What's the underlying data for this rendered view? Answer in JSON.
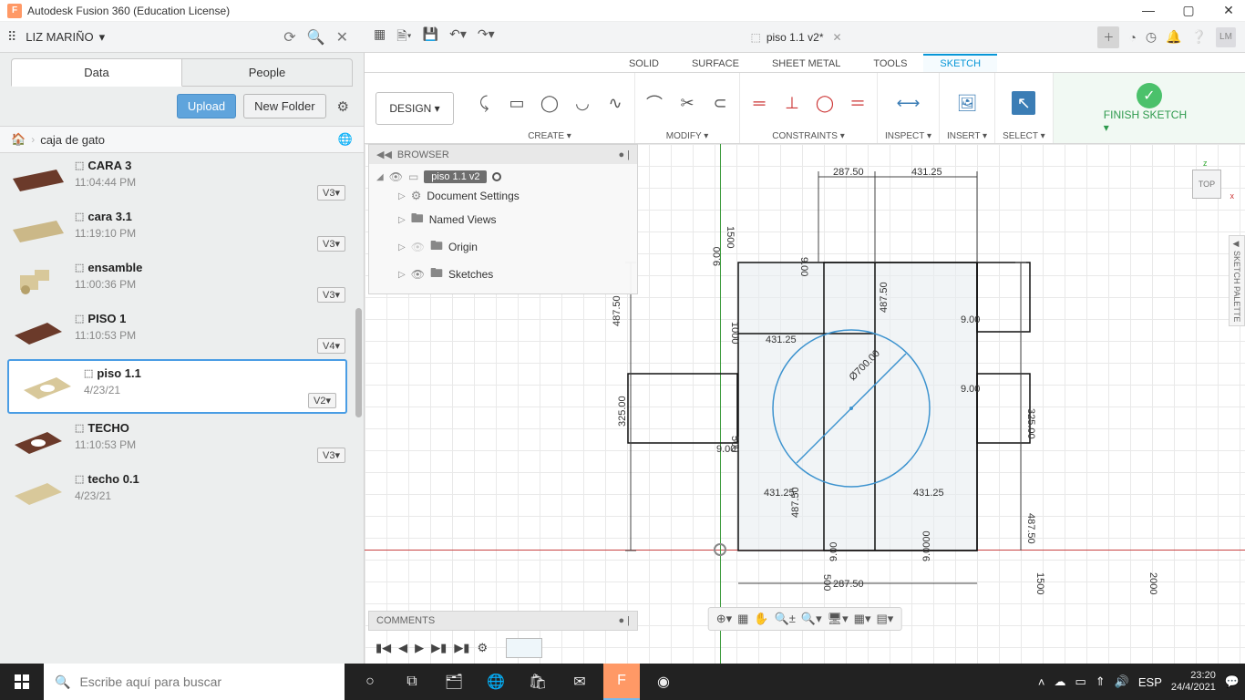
{
  "app": {
    "title": "Autodesk Fusion 360 (Education License)"
  },
  "user": {
    "name": "LIZ MARIÑO",
    "initials": "LM"
  },
  "doc": {
    "name": "piso 1.1 v2*"
  },
  "datapanel": {
    "tabs": {
      "data": "Data",
      "people": "People"
    },
    "upload": "Upload",
    "newfolder": "New Folder",
    "crumb": "caja de gato",
    "items": [
      {
        "name": "CARA 3",
        "ts": "11:04:44 PM",
        "ver": "V3▾",
        "thumb": "plank-brown"
      },
      {
        "name": "cara 3.1",
        "ts": "11:19:10 PM",
        "ver": "V3▾",
        "thumb": "plank-wood"
      },
      {
        "name": "ensamble",
        "ts": "11:00:36 PM",
        "ver": "V3▾",
        "thumb": "assembly"
      },
      {
        "name": "PISO 1",
        "ts": "11:10:53 PM",
        "ver": "V4▾",
        "thumb": "panel-brown"
      },
      {
        "name": "piso 1.1",
        "ts": "4/23/21",
        "ver": "V2▾",
        "thumb": "panel-hole",
        "selected": true
      },
      {
        "name": "TECHO",
        "ts": "11:10:53 PM",
        "ver": "V3▾",
        "thumb": "panel-brown-hole"
      },
      {
        "name": "techo 0.1",
        "ts": "4/23/21",
        "ver": "",
        "thumb": "panel-wood"
      }
    ]
  },
  "env": {
    "tabs": [
      "SOLID",
      "SURFACE",
      "SHEET METAL",
      "TOOLS",
      "SKETCH"
    ],
    "active": 4
  },
  "ribbon": {
    "design": "DESIGN ▾",
    "groups": {
      "create": "CREATE ▾",
      "modify": "MODIFY ▾",
      "constraints": "CONSTRAINTS ▾",
      "inspect": "INSPECT ▾",
      "insert": "INSERT ▾",
      "select": "SELECT ▾",
      "finish": "FINISH SKETCH ▾"
    }
  },
  "browser": {
    "header": "BROWSER",
    "component": "piso 1.1 v2",
    "docsettings": "Document Settings",
    "namedviews": "Named Views",
    "origin": "Origin",
    "sketches": "Sketches"
  },
  "viewcube": {
    "face": "TOP"
  },
  "palette": "SKETCH PALETTE",
  "comments": "COMMENTS",
  "sketch": {
    "dims": {
      "top_left": "287.50",
      "top_right": "431.25",
      "left_h": "1500",
      "left_half": "487.50",
      "left_q": "325.00",
      "right_half_top": "487.50",
      "right_q": "325.00",
      "right_half_bot": "487.50",
      "bot_left": "287.50",
      "bot_right_a": "431.25",
      "mid_left": "431.25",
      "mid_right": "431.25",
      "mid_h1": "1000",
      "mid_h2": "500",
      "small_a": "9.00",
      "small_b": "9.00",
      "small_c": "9.00",
      "small_d": "9.00",
      "small_e": "9.00",
      "small_f": "9.00",
      "small_g": "9.00",
      "inner_h": "487.50",
      "outer_w": "1500",
      "outer_w2": "2000",
      "diam": "Ø700.00",
      "tiny500a": "500",
      "tiny500b": "500",
      "tiny9000": "9.0000"
    }
  },
  "taskbar": {
    "search": "Escribe aquí para buscar",
    "lang": "ESP",
    "time": "23:20",
    "date": "24/4/2021"
  }
}
